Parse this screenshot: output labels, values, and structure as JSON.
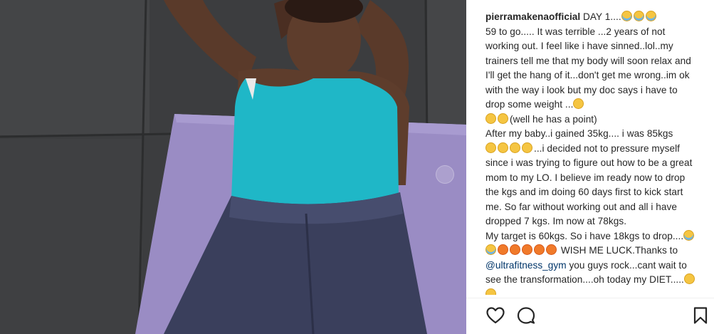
{
  "post": {
    "username": "pierramakenaofficial",
    "caption_parts": [
      {
        "type": "text",
        "value": " DAY 1...."
      },
      {
        "type": "emoji",
        "kind": "cry"
      },
      {
        "type": "emoji",
        "kind": "cry"
      },
      {
        "type": "emoji",
        "kind": "cry"
      },
      {
        "type": "text",
        "value": "\n59 to go..... It was terrible ...2 years of not working out. I feel like i have sinned..lol..my trainers tell me that my body will soon relax and I'll get the hang of it...don't get me wrong..im ok with the way i look but my doc says i have to drop some weight ..."
      },
      {
        "type": "emoji",
        "kind": "flushed"
      },
      {
        "type": "text",
        "value": "\n"
      },
      {
        "type": "emoji",
        "kind": "flushed"
      },
      {
        "type": "emoji",
        "kind": "flushed"
      },
      {
        "type": "text",
        "value": "(well he has a point)\nAfter my baby..i gained 35kg.... i was 85kgs\n"
      },
      {
        "type": "emoji",
        "kind": "flushed"
      },
      {
        "type": "emoji",
        "kind": "flushed"
      },
      {
        "type": "emoji",
        "kind": "flushed"
      },
      {
        "type": "emoji",
        "kind": "flushed"
      },
      {
        "type": "text",
        "value": "...i decided not to pressure myself since i was trying to figure out how to be a great mom to my LO. I believe im ready now to drop the kgs and im doing 60 days first to kick start me. So far without working out and all i have dropped 7 kgs. Im now at 78kgs.\nMy target is 60kgs. So i have 18kgs to drop...."
      },
      {
        "type": "emoji",
        "kind": "cry"
      },
      {
        "type": "emoji",
        "kind": "cry"
      },
      {
        "type": "emoji",
        "kind": "tongue"
      },
      {
        "type": "emoji",
        "kind": "tongue"
      },
      {
        "type": "emoji",
        "kind": "tongue"
      },
      {
        "type": "emoji",
        "kind": "tongue"
      },
      {
        "type": "emoji",
        "kind": "tongue"
      },
      {
        "type": "text",
        "value": " WISH ME LUCK.Thanks to "
      },
      {
        "type": "mention",
        "value": "@ultrafitness_gym"
      },
      {
        "type": "text",
        "value": " you guys rock...cant wait to see the transformation....oh today my DIET....."
      },
      {
        "type": "emoji",
        "kind": "laugh"
      },
      {
        "type": "emoji",
        "kind": "laugh"
      }
    ]
  },
  "actions": {
    "like_icon": "heart-icon",
    "comment_icon": "comment-icon",
    "save_icon": "bookmark-icon"
  },
  "colors": {
    "text": "#262626",
    "mention": "#003569",
    "divider": "#efefef"
  }
}
